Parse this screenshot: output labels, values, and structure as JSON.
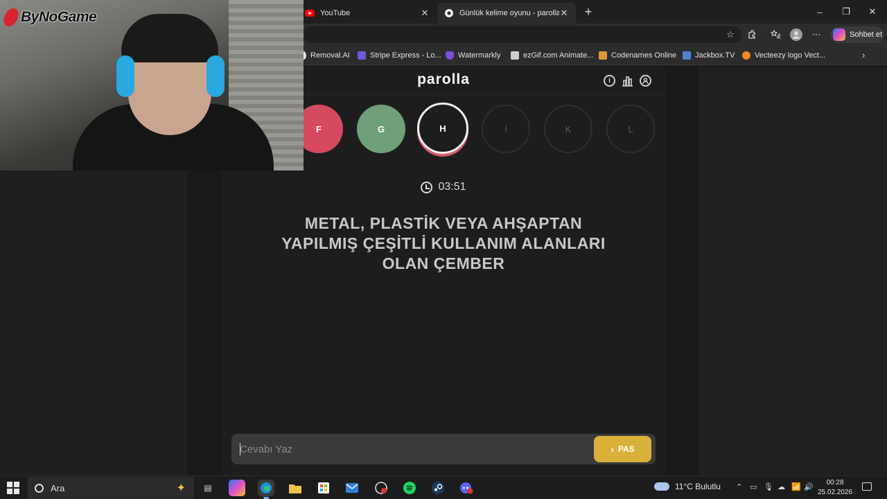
{
  "browser": {
    "tabs": [
      {
        "title": "YouTube",
        "active": false
      },
      {
        "title": "Günlük kelime oyunu - parolla - Ke",
        "active": true
      }
    ],
    "window_controls": {
      "minimize": "–",
      "restore": "❐",
      "close": "✕"
    },
    "new_tab": "+",
    "toolbar": {
      "copilot_label": "Sohbet et"
    },
    "bookmarks": [
      {
        "label": "Removal.AI",
        "color": "#e6e6e6"
      },
      {
        "label": "Stripe Express - Lo...",
        "color": "#6b5bd6"
      },
      {
        "label": "Watermarkly",
        "color": "#7b4fd8"
      },
      {
        "label": "ezGif.com Animate...",
        "color": "#cfcfcf"
      },
      {
        "label": "Codenames Online",
        "color": "#d99a3b"
      },
      {
        "label": "Jackbox.TV",
        "color": "#4a82d8"
      },
      {
        "label": "Vecteezy logo Vect...",
        "color": "#f08a24"
      }
    ]
  },
  "game": {
    "brand": "parolla",
    "header_icons": [
      "info-icon",
      "stats-icon",
      "profile-icon"
    ],
    "letters": [
      {
        "letter": "F",
        "state": "wrong"
      },
      {
        "letter": "G",
        "state": "correct"
      },
      {
        "letter": "H",
        "state": "current"
      },
      {
        "letter": "İ",
        "state": "pending"
      },
      {
        "letter": "K",
        "state": "pending"
      },
      {
        "letter": "L",
        "state": "pending"
      }
    ],
    "timer": "03:51",
    "question": "METAL, PLASTİK VEYA AHŞAPTAN YAPILMIŞ ÇEŞİTLİ KULLANIM ALANLARI OLAN ÇEMBER",
    "answer_placeholder": "Cevabı Yaz",
    "pass_label": "PAS",
    "colors": {
      "wrong": "#d64a5f",
      "correct": "#6fa07a",
      "pass": "#d9b13a"
    }
  },
  "overlay": {
    "watermark": "ByNoGame"
  },
  "taskbar": {
    "search_placeholder": "Ara",
    "weather": "11°C  Bulutlu",
    "time": "00:28",
    "date": "25.02.2026"
  }
}
